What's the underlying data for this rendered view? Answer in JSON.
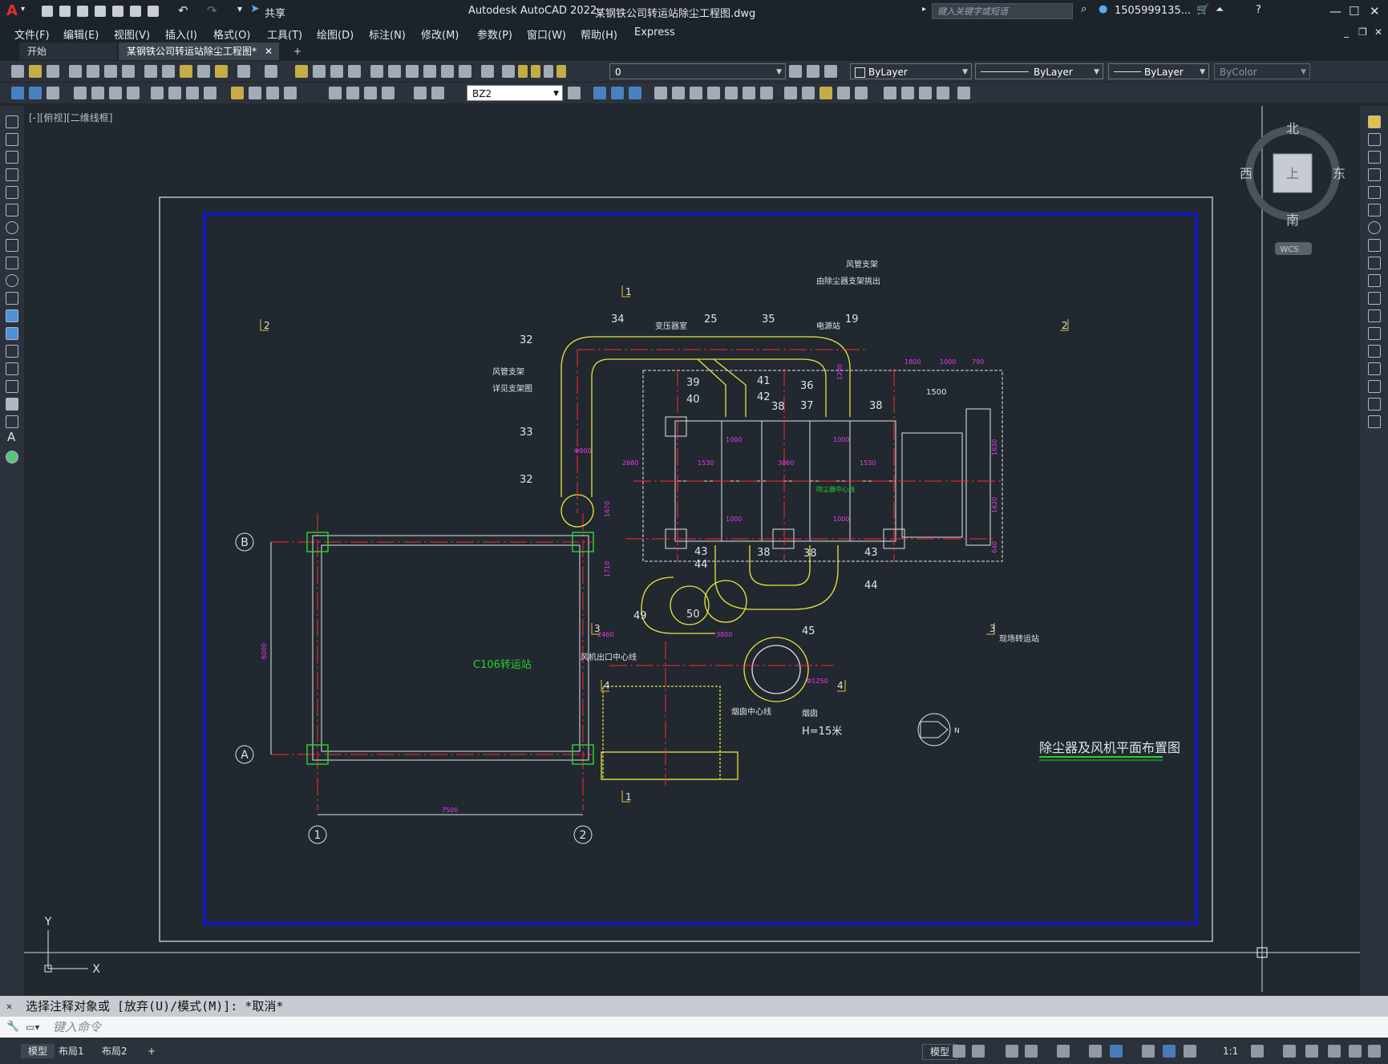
{
  "app": {
    "title": "Autodesk AutoCAD 2022",
    "filename": "某钢铁公司转运站除尘工程图.dwg",
    "share_label": "共享",
    "search_placeholder": "键入关键字或短语",
    "user": "1505999135..."
  },
  "menu": [
    "文件(F)",
    "编辑(E)",
    "视图(V)",
    "插入(I)",
    "格式(O)",
    "工具(T)",
    "绘图(D)",
    "标注(N)",
    "修改(M)",
    "参数(P)",
    "窗口(W)",
    "帮助(H)",
    "Express"
  ],
  "tabs": {
    "start": "开始",
    "doc": "某钢铁公司转运站除尘工程图*",
    "add": "+"
  },
  "toolbar": {
    "layer": "0",
    "color": "ByLayer",
    "linetype": "ByLayer",
    "lineweight": "ByLayer",
    "plotstyle": "ByColor",
    "dimstyle": "BZ2"
  },
  "viewport_label": "[-][俯视][二维线框]",
  "viewcube": {
    "n": "北",
    "s": "南",
    "e": "东",
    "w": "西",
    "top": "上",
    "wcs": "WCS"
  },
  "ucs": {
    "x": "X",
    "y": "Y"
  },
  "drawing": {
    "title": "除尘器及风机平面布置图",
    "grid_rows": [
      "B",
      "A"
    ],
    "grid_cols": [
      "1",
      "2"
    ],
    "dims": {
      "span": "7500",
      "height": "6000",
      "d2460": "2460",
      "d3800": "3800",
      "d1800": "1800",
      "d1000": "1000",
      "d790": "790",
      "d1530a": "1530",
      "d3060": "3060",
      "d1530b": "1530",
      "d1000a": "1000",
      "d1000b": "1000",
      "d1000c": "1000",
      "d1000d": "1000",
      "d1500": "1500",
      "d1630": "1630",
      "d1620": "1620",
      "d640": "640",
      "d2680": "2680",
      "d1670": "1670",
      "d1710": "1710",
      "phi900": "Φ900",
      "phi1250": "Φ1250",
      "d1200": "1200"
    },
    "labels": {
      "l34": "34",
      "l25": "25",
      "l35": "35",
      "l19": "19",
      "l32a": "32",
      "l33": "33",
      "l32b": "32",
      "l39": "39",
      "l40": "40",
      "l41": "41",
      "l42": "42",
      "l38a": "38",
      "l36": "36",
      "l37": "37",
      "l38b": "38",
      "l43a": "43",
      "l44a": "44",
      "l38c": "38",
      "l38d": "38",
      "l43b": "43",
      "l44b": "44",
      "l49": "49",
      "l50": "50",
      "l45": "45",
      "transformer": "变压器室",
      "elec": "电源站",
      "duct_support": "风管支架",
      "duct_support_sub": "由除尘器支架挑出",
      "duct_support2": "风管支架",
      "duct_support2_sub": "详见支架图",
      "dust_center": "除尘器中心线",
      "fan_center": "风机出口中心线",
      "chimney_center": "烟囱中心线",
      "chimney": "烟囱",
      "chimney_h": "H=15米",
      "station": "C106转运站",
      "station2": "现场转运站",
      "sec1": "1",
      "sec2": "2",
      "sec3": "3",
      "sec4": "4",
      "north": "N"
    }
  },
  "command": {
    "history": "选择注释对象或 [放弃(U)/模式(M)]: *取消*",
    "placeholder": "键入命令"
  },
  "status": {
    "model": "模型",
    "layout1": "布局1",
    "layout2": "布局2",
    "add": "+",
    "model_btn": "模型",
    "scale": "1:1"
  }
}
